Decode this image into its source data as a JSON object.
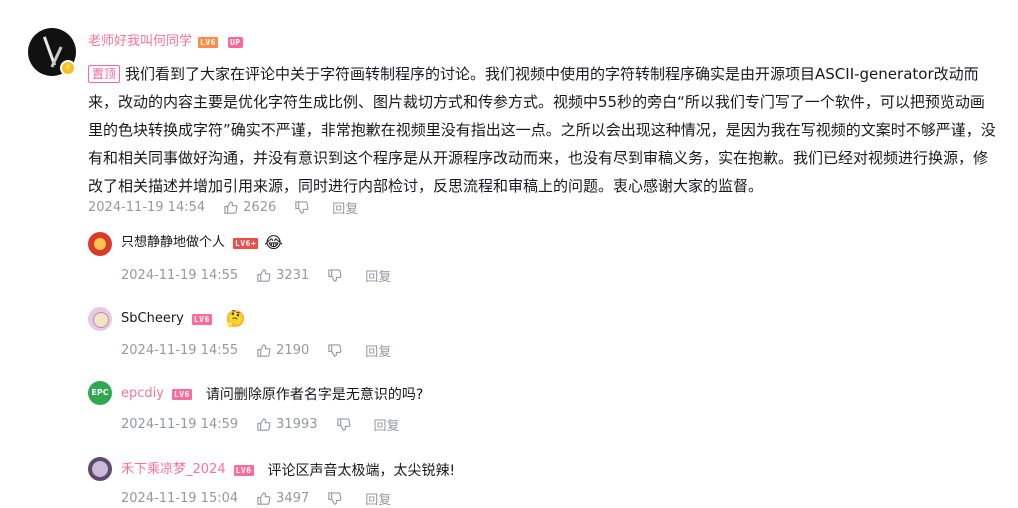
{
  "main_comment": {
    "username": "老师好我叫何同学",
    "level": "LV6",
    "up_badge": "UP",
    "pinned_label": "置顶",
    "text": "我们看到了大家在评论中关于字符画转制程序的讨论。我们视频中使用的字符转制程序确实是由开源项目ASCII-generator改动而来，改动的内容主要是优化字符生成比例、图片裁切方式和传参方式。视频中55秒的旁白“所以我们专门写了一个软件，可以把预览动画里的色块转换成字符”确实不严谨，非常抱歉在视频里没有指出这一点。之所以会出现这种情况，是因为我在写视频的文案时不够严谨，没有和相关同事做好沟通，并没有意识到这个程序是从开源程序改动而来，也没有尽到审稿义务，实在抱歉。我们已经对视频进行换源，修改了相关描述并增加引用来源，同时进行内部检讨，反思流程和审稿上的问题。衷心感谢大家的监督。",
    "time": "2024-11-19 14:54",
    "likes": "2626",
    "reply_label": "回复"
  },
  "replies": [
    {
      "username": "只想静静地做个人",
      "level": "LV6+",
      "text": "",
      "emoji": "😂",
      "time": "2024-11-19 14:55",
      "likes": "3231",
      "reply_label": "回复",
      "username_color": "#18191c",
      "avatar_color": "#d93a2b"
    },
    {
      "username": "SbCheery",
      "level": "LV6",
      "text": "",
      "emoji": "🤔",
      "time": "2024-11-19 14:55",
      "likes": "2190",
      "reply_label": "回复",
      "username_color": "#18191c",
      "avatar_color": "#e9c8e6"
    },
    {
      "username": "epcdiy",
      "level": "LV6",
      "text": "请问删除原作者名字是无意识的吗?",
      "emoji": "",
      "time": "2024-11-19 14:59",
      "likes": "31993",
      "reply_label": "回复",
      "username_color": "#fb7299",
      "avatar_color": "#2fa84f",
      "avatar_text": "EPC"
    },
    {
      "username": "禾下乘凉梦_2024",
      "level": "LV6",
      "text": "评论区声音太极端，太尖锐辣!",
      "emoji": "",
      "time": "2024-11-19 15:04",
      "likes": "3497",
      "reply_label": "回复",
      "username_color": "#fb7299",
      "avatar_color": "#5b4a6e"
    }
  ],
  "colors": {
    "accent": "#fb7299",
    "meta": "#9499a0",
    "text": "#18191c"
  }
}
